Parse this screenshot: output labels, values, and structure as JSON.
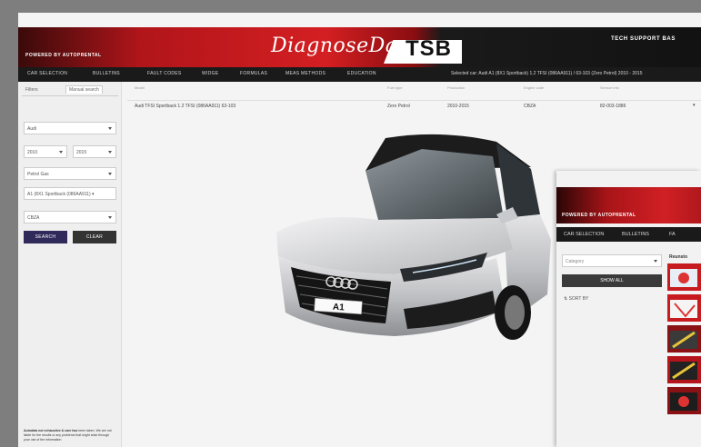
{
  "header": {
    "powered_by": "POWERED BY AUTOPRENTAL",
    "brand_script": "DiagnoseDan",
    "brand_block": "TSB",
    "tagline": "TECH SUPPORT BAS"
  },
  "nav": {
    "items": [
      "CAR SELECTION",
      "BULLETINS",
      "FAULT CODES",
      "WIDGE",
      "FORMULAS",
      "MEAS METHODS",
      "EDUCATION"
    ],
    "selected_vehicle": "Selected car: Audi A1 (8X1 Sportback) 1.2 TFSI (086AA911) / 63-103 (Zero Petrol) 2010 - 2015"
  },
  "sidebar": {
    "tabs": [
      "Filters",
      "Manual search"
    ],
    "selects": {
      "make": "Audi",
      "year_from": "2010",
      "year_to": "2015",
      "fuel": "Petrol Gas",
      "model": "A1 (8X1 Sportback (086AA911) ▾",
      "engine": "CBZA"
    },
    "search_label": "SEARCH",
    "clear_label": "CLEAR",
    "footnote_bold": "Autodata not exhaustive & care has",
    "footnote": "been taken. We are not liable for the results or any problems that might arise through your use of the information"
  },
  "results": {
    "headers": [
      "Model",
      "Fuel type",
      "Production",
      "Engine code",
      "Service info"
    ],
    "row": [
      "Audi TFSI Sportback 1.2 TFSI (086AA911) 63-103",
      "Zero Petrol",
      "2010-2015",
      "CBZA",
      "82-003-1886"
    ]
  },
  "overlay": {
    "powered_by": "POWERED BY AUTOPRENTAL",
    "nav": [
      "CAR SELECTION",
      "BULLETINS",
      "FA"
    ],
    "category_placeholder": "Category",
    "show_all_label": "SHOW ALL",
    "sort_by": "SORT BY",
    "results_label": "Reunsto"
  },
  "car_badge": "A1"
}
